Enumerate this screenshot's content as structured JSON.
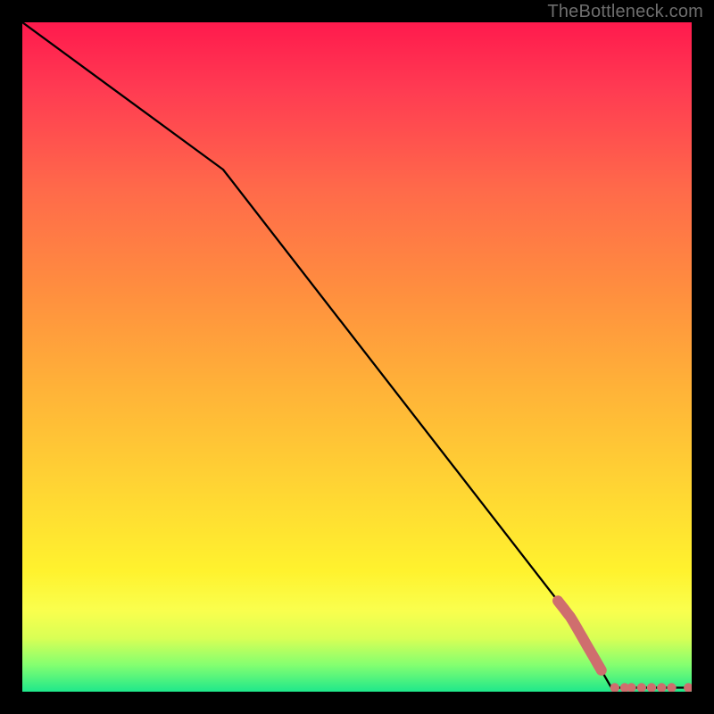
{
  "watermark": "TheBottleneck.com",
  "chart_data": {
    "type": "line",
    "title": "",
    "xlabel": "",
    "ylabel": "",
    "xlim": [
      0,
      100
    ],
    "ylim": [
      0,
      100
    ],
    "grid": false,
    "series": [
      {
        "name": "curve",
        "x": [
          0,
          30,
          82,
          88,
          100
        ],
        "y": [
          100,
          78,
          11,
          0.6,
          0.6
        ]
      }
    ],
    "markers": {
      "name": "points",
      "color": "#cf6e6e",
      "clusters": [
        {
          "x_start": 80,
          "x_end": 86.5,
          "along_curve": true,
          "shape": "pill"
        },
        {
          "x_points": [
            88.5,
            90,
            91,
            92.5,
            94,
            95.5,
            97,
            99.5
          ],
          "y": 0.6,
          "shape": "dot"
        }
      ]
    },
    "background_gradient": {
      "direction": "vertical",
      "stops": [
        {
          "pos": 0.0,
          "color": "#ff1a4d"
        },
        {
          "pos": 0.55,
          "color": "#ffb338"
        },
        {
          "pos": 0.82,
          "color": "#fff22e"
        },
        {
          "pos": 1.0,
          "color": "#1fe88b"
        }
      ]
    }
  }
}
